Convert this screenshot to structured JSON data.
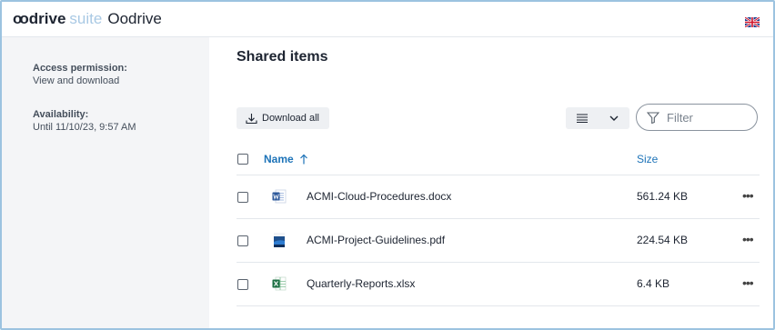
{
  "header": {
    "brand": "odrive",
    "suite": "suite",
    "org": "Oodrive",
    "language_icon": "uk-flag-icon"
  },
  "sidebar": {
    "access_label": "Access permission:",
    "access_value": "View and download",
    "availability_label": "Availability:",
    "availability_value": "Until 11/10/23, 9:57 AM"
  },
  "main": {
    "title": "Shared items",
    "download_all": "Download all",
    "filter_placeholder": "Filter"
  },
  "table": {
    "col_name": "Name",
    "col_size": "Size",
    "rows": [
      {
        "name": "ACMI-Cloud-Procedures.docx",
        "size": "561.24 KB",
        "icon": "word-file-icon"
      },
      {
        "name": "ACMI-Project-Guidelines.pdf",
        "size": "224.54 KB",
        "icon": "pdf-file-icon"
      },
      {
        "name": "Quarterly-Reports.xlsx",
        "size": "6.4 KB",
        "icon": "excel-file-icon"
      }
    ]
  },
  "colors": {
    "accent": "#1d73b8",
    "sidebar_bg": "#f4f5f7",
    "frame_border": "#9cc3e0"
  }
}
